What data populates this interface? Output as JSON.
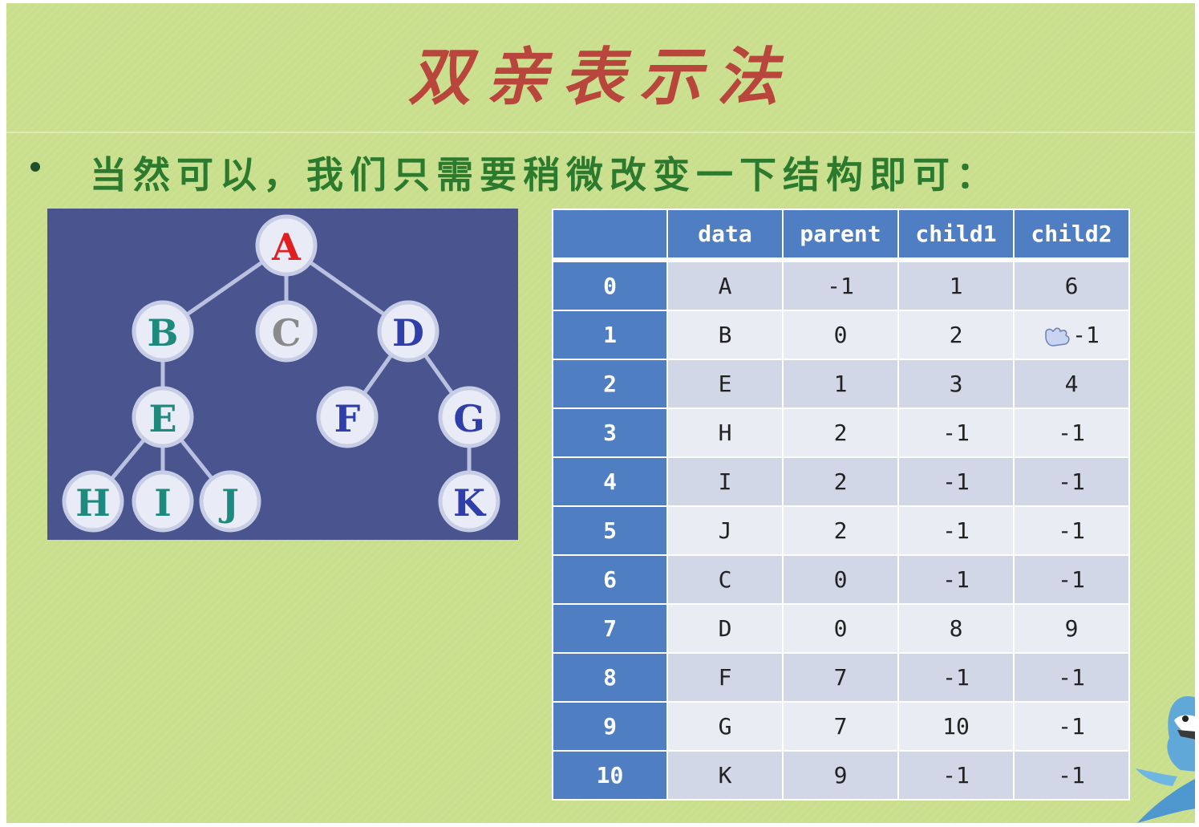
{
  "title": "双亲表示法",
  "bullet": "当然可以，我们只需要稍微改变一下结构即可：",
  "tree": {
    "nodes": [
      {
        "id": "A",
        "color": "#e02020"
      },
      {
        "id": "B",
        "color": "#1e8a7e"
      },
      {
        "id": "C",
        "color": "#8a8a8a"
      },
      {
        "id": "D",
        "color": "#2f3ea8"
      },
      {
        "id": "E",
        "color": "#1e8a7e"
      },
      {
        "id": "F",
        "color": "#2f3ea8"
      },
      {
        "id": "G",
        "color": "#2f3ea8"
      },
      {
        "id": "H",
        "color": "#1e8a7e"
      },
      {
        "id": "I",
        "color": "#1e8a7e"
      },
      {
        "id": "J",
        "color": "#1e8a7e"
      },
      {
        "id": "K",
        "color": "#2f3ea8"
      }
    ],
    "edges": [
      [
        "A",
        "B"
      ],
      [
        "A",
        "C"
      ],
      [
        "A",
        "D"
      ],
      [
        "B",
        "E"
      ],
      [
        "E",
        "H"
      ],
      [
        "E",
        "I"
      ],
      [
        "E",
        "J"
      ],
      [
        "D",
        "F"
      ],
      [
        "D",
        "G"
      ],
      [
        "G",
        "K"
      ]
    ]
  },
  "table": {
    "headers": [
      "",
      "data",
      "parent",
      "child1",
      "child2"
    ],
    "rows": [
      {
        "index": "0",
        "data": "A",
        "parent": "-1",
        "child1": "1",
        "child2": "6"
      },
      {
        "index": "1",
        "data": "B",
        "parent": "0",
        "child1": "2",
        "child2": "-1"
      },
      {
        "index": "2",
        "data": "E",
        "parent": "1",
        "child1": "3",
        "child2": "4"
      },
      {
        "index": "3",
        "data": "H",
        "parent": "2",
        "child1": "-1",
        "child2": "-1"
      },
      {
        "index": "4",
        "data": "I",
        "parent": "2",
        "child1": "-1",
        "child2": "-1"
      },
      {
        "index": "5",
        "data": "J",
        "parent": "2",
        "child1": "-1",
        "child2": "-1"
      },
      {
        "index": "6",
        "data": "C",
        "parent": "0",
        "child1": "-1",
        "child2": "-1"
      },
      {
        "index": "7",
        "data": "D",
        "parent": "0",
        "child1": "8",
        "child2": "9"
      },
      {
        "index": "8",
        "data": "F",
        "parent": "7",
        "child1": "-1",
        "child2": "-1"
      },
      {
        "index": "9",
        "data": "G",
        "parent": "7",
        "child1": "10",
        "child2": "-1"
      },
      {
        "index": "10",
        "data": "K",
        "parent": "9",
        "child1": "-1",
        "child2": "-1"
      }
    ]
  },
  "icons": {
    "cursor": "hand-pointer-icon",
    "mascot": "shark-mascot-icon"
  }
}
